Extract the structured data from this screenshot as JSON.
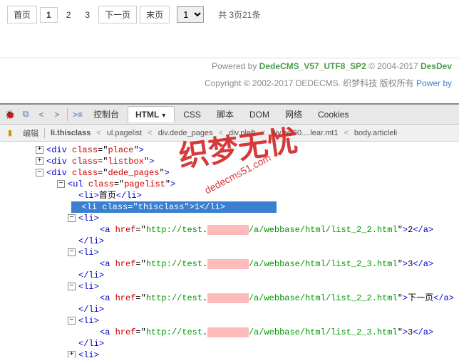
{
  "pagination": {
    "first": "首页",
    "pages": [
      "1",
      "2",
      "3"
    ],
    "active_index": 0,
    "next": "下一页",
    "last": "末页",
    "select_value": "1",
    "info": "共 3页21条"
  },
  "footer": {
    "powered_prefix": "Powered by ",
    "powered_link": "DedeCMS_V57_UTF8_SP2",
    "powered_suffix": " © 2004-2017 ",
    "desdev": "DesDev",
    "copyright": "Copyright © 2002-2017 DEDECMS. 织梦科技 版权所有 ",
    "powerby_label": "Power by "
  },
  "devtools": {
    "tabs": [
      "控制台",
      "HTML",
      "CSS",
      "脚本",
      "DOM",
      "网络",
      "Cookies"
    ],
    "active_tab": 1,
    "edit": "编辑",
    "breadcrumb": [
      "li.thisclass",
      "ul.pagelist",
      "div.dede_pages",
      "div.pleft",
      "div.w960....lear.mt1",
      "body.articleli"
    ]
  },
  "dom": {
    "n0": {
      "tag": "div",
      "attr": "class",
      "val": "place"
    },
    "n1": {
      "tag": "div",
      "attr": "class",
      "val": "listbox"
    },
    "n2": {
      "tag": "div",
      "attr": "class",
      "val": "dede_pages"
    },
    "n3": {
      "tag": "ul",
      "attr": "class",
      "val": "pagelist"
    },
    "n4": {
      "tag": "li",
      "text": "首页"
    },
    "n5": {
      "tag": "li",
      "attr": "class",
      "val": "thisclass",
      "text": "1"
    },
    "n6": {
      "tag": "li"
    },
    "a1": {
      "href_pre": "http://test",
      "href_post": "/a/webbase/html/list_2_2.html",
      "text": "2"
    },
    "a2": {
      "href_pre": "http://test",
      "href_post": "/a/webbase/html/list_2_3.html",
      "text": "3"
    },
    "a3": {
      "href_pre": "http://test",
      "href_post": "/a/webbase/html/list_2_2.html",
      "text": "下一页"
    },
    "a4": {
      "href_pre": "http://test",
      "href_post": "/a/webbase/html/list_2_3.html",
      "text": "3"
    }
  },
  "watermark": {
    "cn": "织梦无忧",
    "url": "dedecms51.com"
  }
}
